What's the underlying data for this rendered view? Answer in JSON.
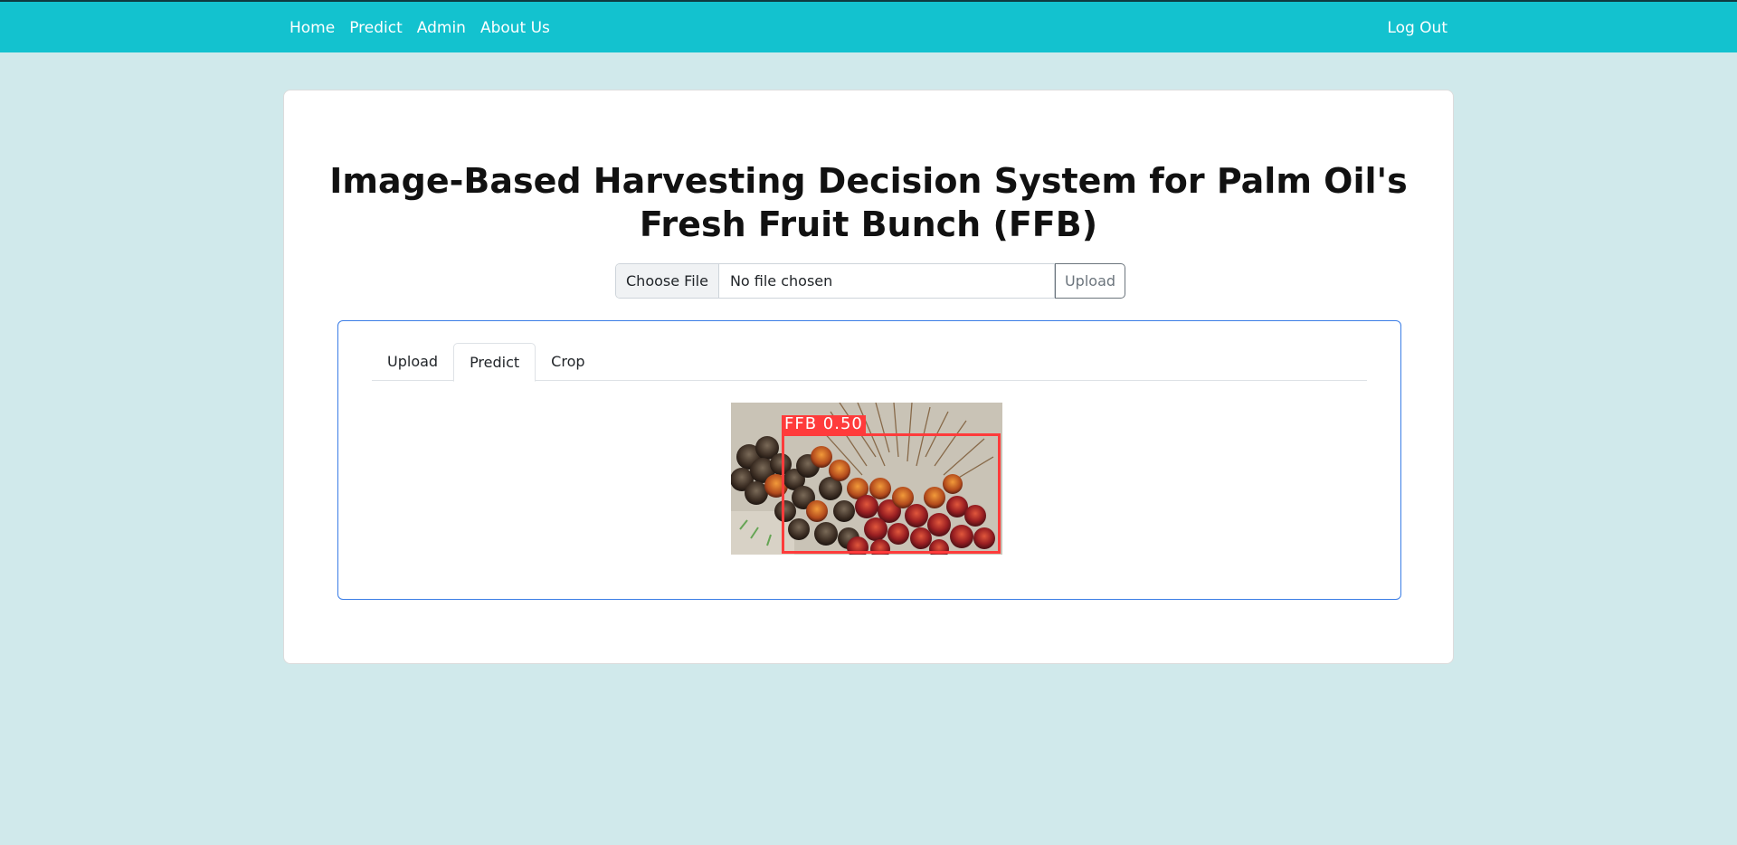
{
  "nav": {
    "items": [
      {
        "label": "Home"
      },
      {
        "label": "Predict"
      },
      {
        "label": "Admin"
      },
      {
        "label": "About Us"
      }
    ],
    "logout_label": "Log Out"
  },
  "main": {
    "title_line1": "Image-Based Harvesting Decision System for Palm Oil's",
    "title_line2": "Fresh Fruit Bunch (FFB)",
    "file": {
      "choose_label": "Choose File",
      "status": "No file chosen",
      "upload_label": "Upload"
    },
    "tabs": [
      {
        "label": "Upload",
        "active": false
      },
      {
        "label": "Predict",
        "active": true
      },
      {
        "label": "Crop",
        "active": false
      }
    ],
    "prediction": {
      "label": "FFB 0.50"
    }
  },
  "colors": {
    "navbar": "#13c2cf",
    "page_bg": "#d0e9eb",
    "bbox": "#ff3b3b",
    "inner_border": "#3c7ee6"
  }
}
